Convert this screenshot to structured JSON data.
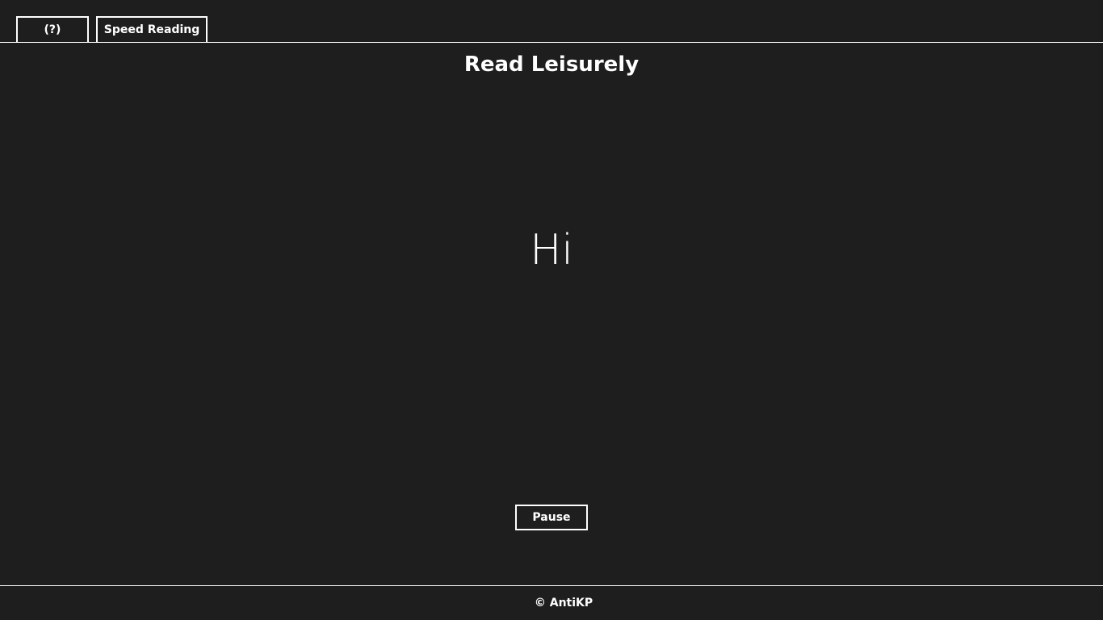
{
  "header": {
    "help_label": "(?)",
    "speed_reading_label": "Speed Reading"
  },
  "main": {
    "title": "Read Leisurely",
    "current_word": "Hi",
    "pause_label": "Pause"
  },
  "footer": {
    "copyright": "© AntiKP"
  },
  "colors": {
    "background": "#1e1e1e",
    "foreground": "#ffffff"
  }
}
